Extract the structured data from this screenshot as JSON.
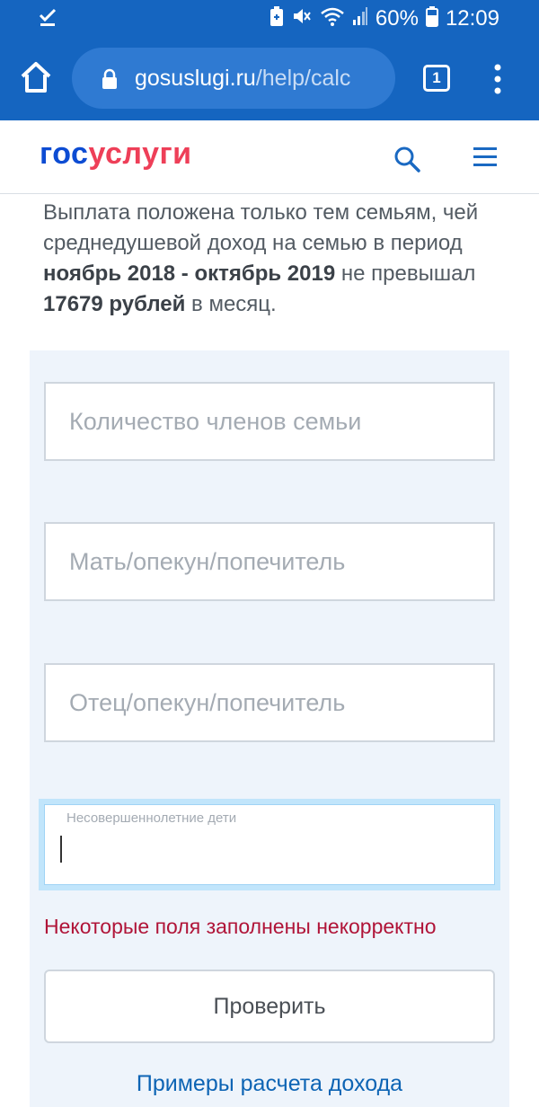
{
  "status_bar": {
    "left_icon": "download-done-icon",
    "icons": [
      "battery-saver-icon",
      "mute-icon",
      "wifi-icon",
      "signal-icon",
      "battery-icon"
    ],
    "battery": "60%",
    "time": "12:09"
  },
  "browser": {
    "url_host": "gosuslugi.ru",
    "url_path": "/help/calc",
    "tab_count": "1"
  },
  "header": {
    "logo_part1": "гос",
    "logo_part2": "услуги"
  },
  "info": {
    "text_1": "Выплата положена только тем семьям, чей среднедушевой доход на семью в период ",
    "bold_period": "ноябрь 2018 - октябрь 2019",
    "text_2": " не превышал ",
    "bold_amount": "17679 рублей",
    "text_3": " в месяц."
  },
  "form": {
    "family_members_placeholder": "Количество членов семьи",
    "mother_placeholder": "Мать/опекун/попечитель",
    "father_placeholder": "Отец/опекун/попечитель",
    "children_label": "Несовершеннолетние дети",
    "children_value": "",
    "error_message": "Некоторые поля заполнены некорректно",
    "check_button": "Проверить",
    "examples_link": "Примеры расчета дохода"
  },
  "colors": {
    "primary": "#1565c0",
    "logo_blue": "#0d4cd3",
    "logo_red": "#ee3f58",
    "error": "#b01438",
    "link": "#0d64b4",
    "focus": "#c1e5fb"
  }
}
